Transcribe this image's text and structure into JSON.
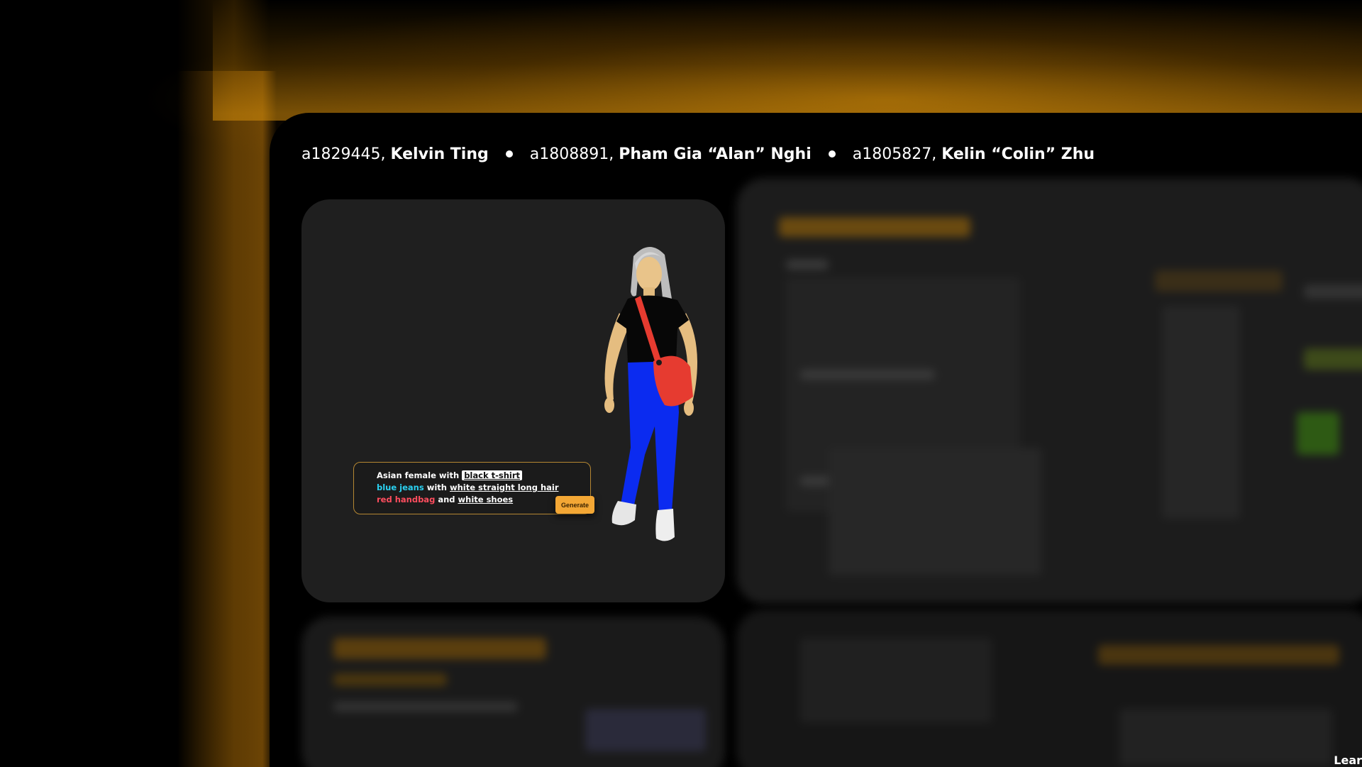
{
  "credits": [
    {
      "id": "a1829445,",
      "name": "Kelvin Ting"
    },
    {
      "id": "a1808891,",
      "name": "Pham Gia “Alan” Nghi"
    },
    {
      "id": "a1805827,",
      "name": "Kelin “Colin” Zhu"
    }
  ],
  "prompt": {
    "line1_a": "Asian female with",
    "line1_b": "black t-shirt",
    "line2_a": "blue jeans",
    "line2_b": "with",
    "line2_c": "white straight long hair",
    "line3_a": "red handbag",
    "line3_b": "and",
    "line3_c": "white shoes"
  },
  "generate_label": "Generate",
  "corner_text": "Lear",
  "colors": {
    "accent_orange": "#f3a735",
    "prompt_border": "#b58732",
    "cyan_token": "#2ad0f0",
    "red_token": "#ff4d5e",
    "card_bg": "#1f1f1f",
    "jeans_blue": "#0b2bf0",
    "bag_red": "#e63b30"
  }
}
